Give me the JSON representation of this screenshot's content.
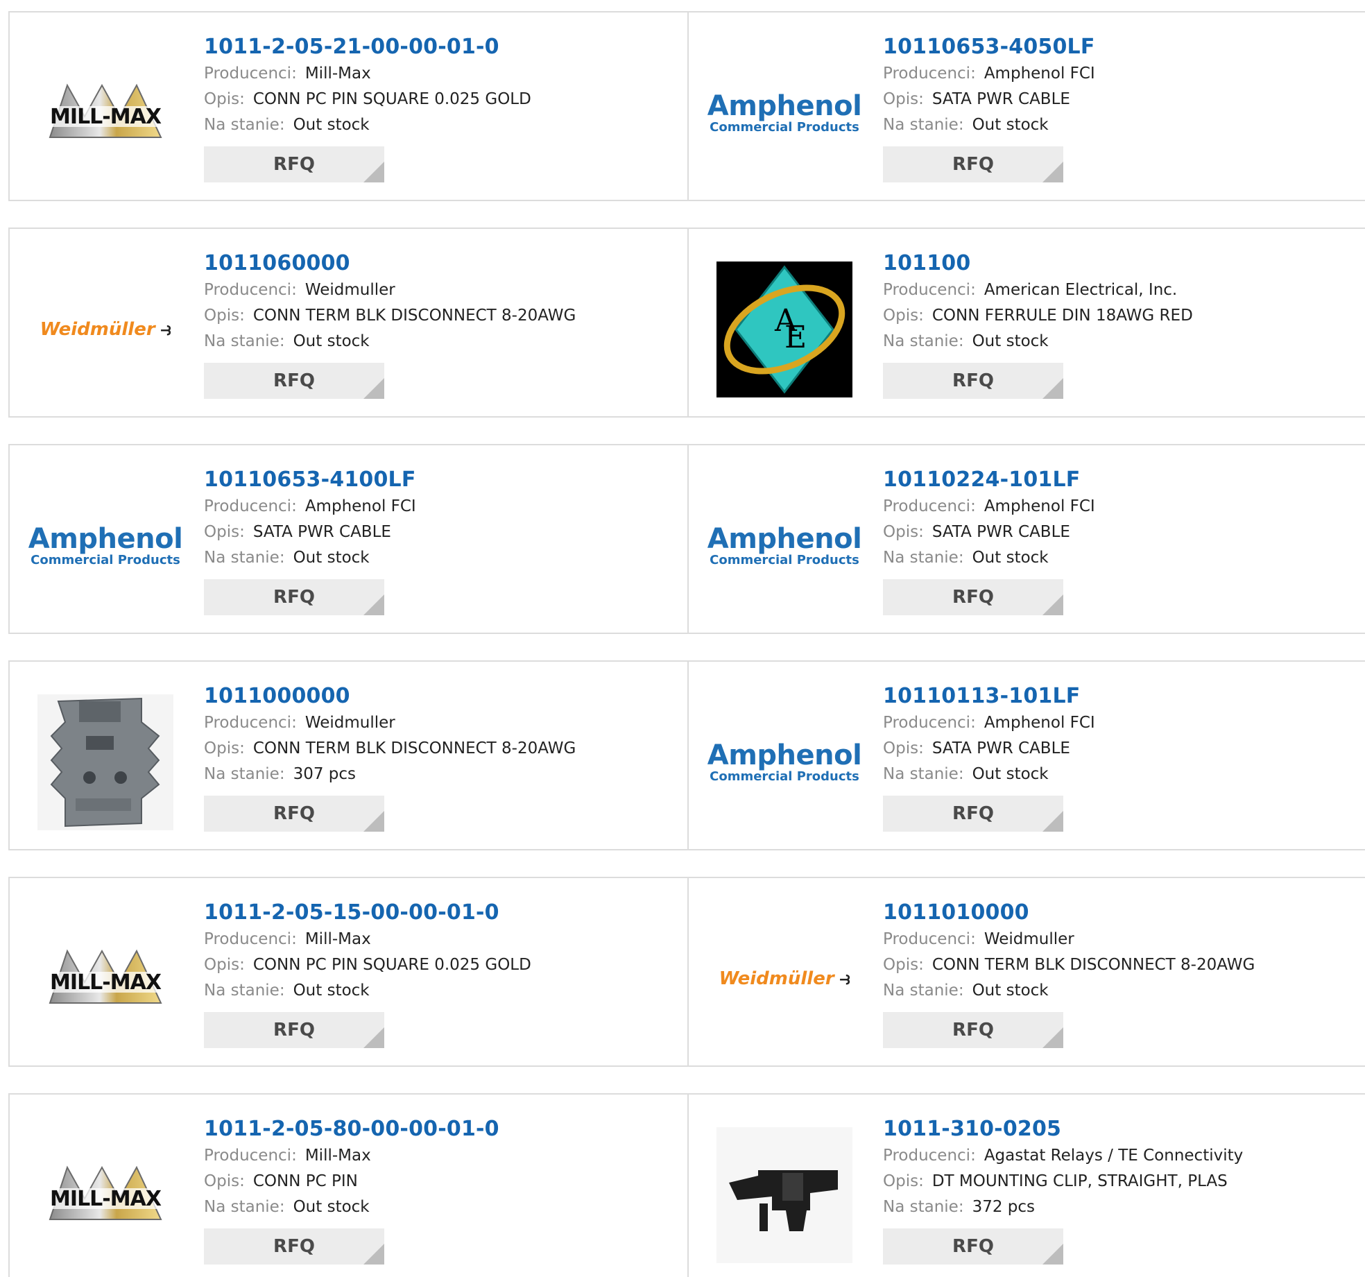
{
  "labels": {
    "manufacturer": "Producenci:",
    "description": "Opis:",
    "stock": "Na stanie:",
    "rfq": "RFQ"
  },
  "logos": {
    "amphenol_line1": "Amphenol",
    "amphenol_line2": "Commercial Products",
    "weidmuller": "Weidmüller",
    "weidmuller_symbol": "⥽",
    "millmax": "MILL-MAX"
  },
  "products": [
    {
      "part": "1011-2-05-21-00-00-01-0",
      "manufacturer": "Mill-Max",
      "description": "CONN PC PIN SQUARE 0.025 GOLD",
      "stock": "Out stock",
      "logo": "millmax"
    },
    {
      "part": "10110653-4050LF",
      "manufacturer": "Amphenol FCI",
      "description": "SATA PWR CABLE",
      "stock": "Out stock",
      "logo": "amphenol"
    },
    {
      "part": "1011060000",
      "manufacturer": "Weidmuller",
      "description": "CONN TERM BLK DISCONNECT 8-20AWG",
      "stock": "Out stock",
      "logo": "weidmuller"
    },
    {
      "part": "101100",
      "manufacturer": "American Electrical, Inc.",
      "description": "CONN FERRULE DIN 18AWG RED",
      "stock": "Out stock",
      "logo": "ae"
    },
    {
      "part": "10110653-4100LF",
      "manufacturer": "Amphenol FCI",
      "description": "SATA PWR CABLE",
      "stock": "Out stock",
      "logo": "amphenol"
    },
    {
      "part": "10110224-101LF",
      "manufacturer": "Amphenol FCI",
      "description": "SATA PWR CABLE",
      "stock": "Out stock",
      "logo": "amphenol"
    },
    {
      "part": "1011000000",
      "manufacturer": "Weidmuller",
      "description": "CONN TERM BLK DISCONNECT 8-20AWG",
      "stock": "307 pcs",
      "logo": "terminal-block"
    },
    {
      "part": "10110113-101LF",
      "manufacturer": "Amphenol FCI",
      "description": "SATA PWR CABLE",
      "stock": "Out stock",
      "logo": "amphenol"
    },
    {
      "part": "1011-2-05-15-00-00-01-0",
      "manufacturer": "Mill-Max",
      "description": "CONN PC PIN SQUARE 0.025 GOLD",
      "stock": "Out stock",
      "logo": "millmax"
    },
    {
      "part": "1011010000",
      "manufacturer": "Weidmuller",
      "description": "CONN TERM BLK DISCONNECT 8-20AWG",
      "stock": "Out stock",
      "logo": "weidmuller"
    },
    {
      "part": "1011-2-05-80-00-00-01-0",
      "manufacturer": "Mill-Max",
      "description": "CONN PC PIN",
      "stock": "Out stock",
      "logo": "millmax"
    },
    {
      "part": "1011-310-0205",
      "manufacturer": "Agastat Relays / TE Connectivity",
      "description": "DT MOUNTING CLIP, STRAIGHT, PLAS",
      "stock": "372 pcs",
      "logo": "mounting-clip"
    }
  ],
  "colors": {
    "part_link": "#1565b0",
    "label_gray": "#8a8a8a",
    "border": "#dcdcdc",
    "button_bg": "#ececec"
  }
}
